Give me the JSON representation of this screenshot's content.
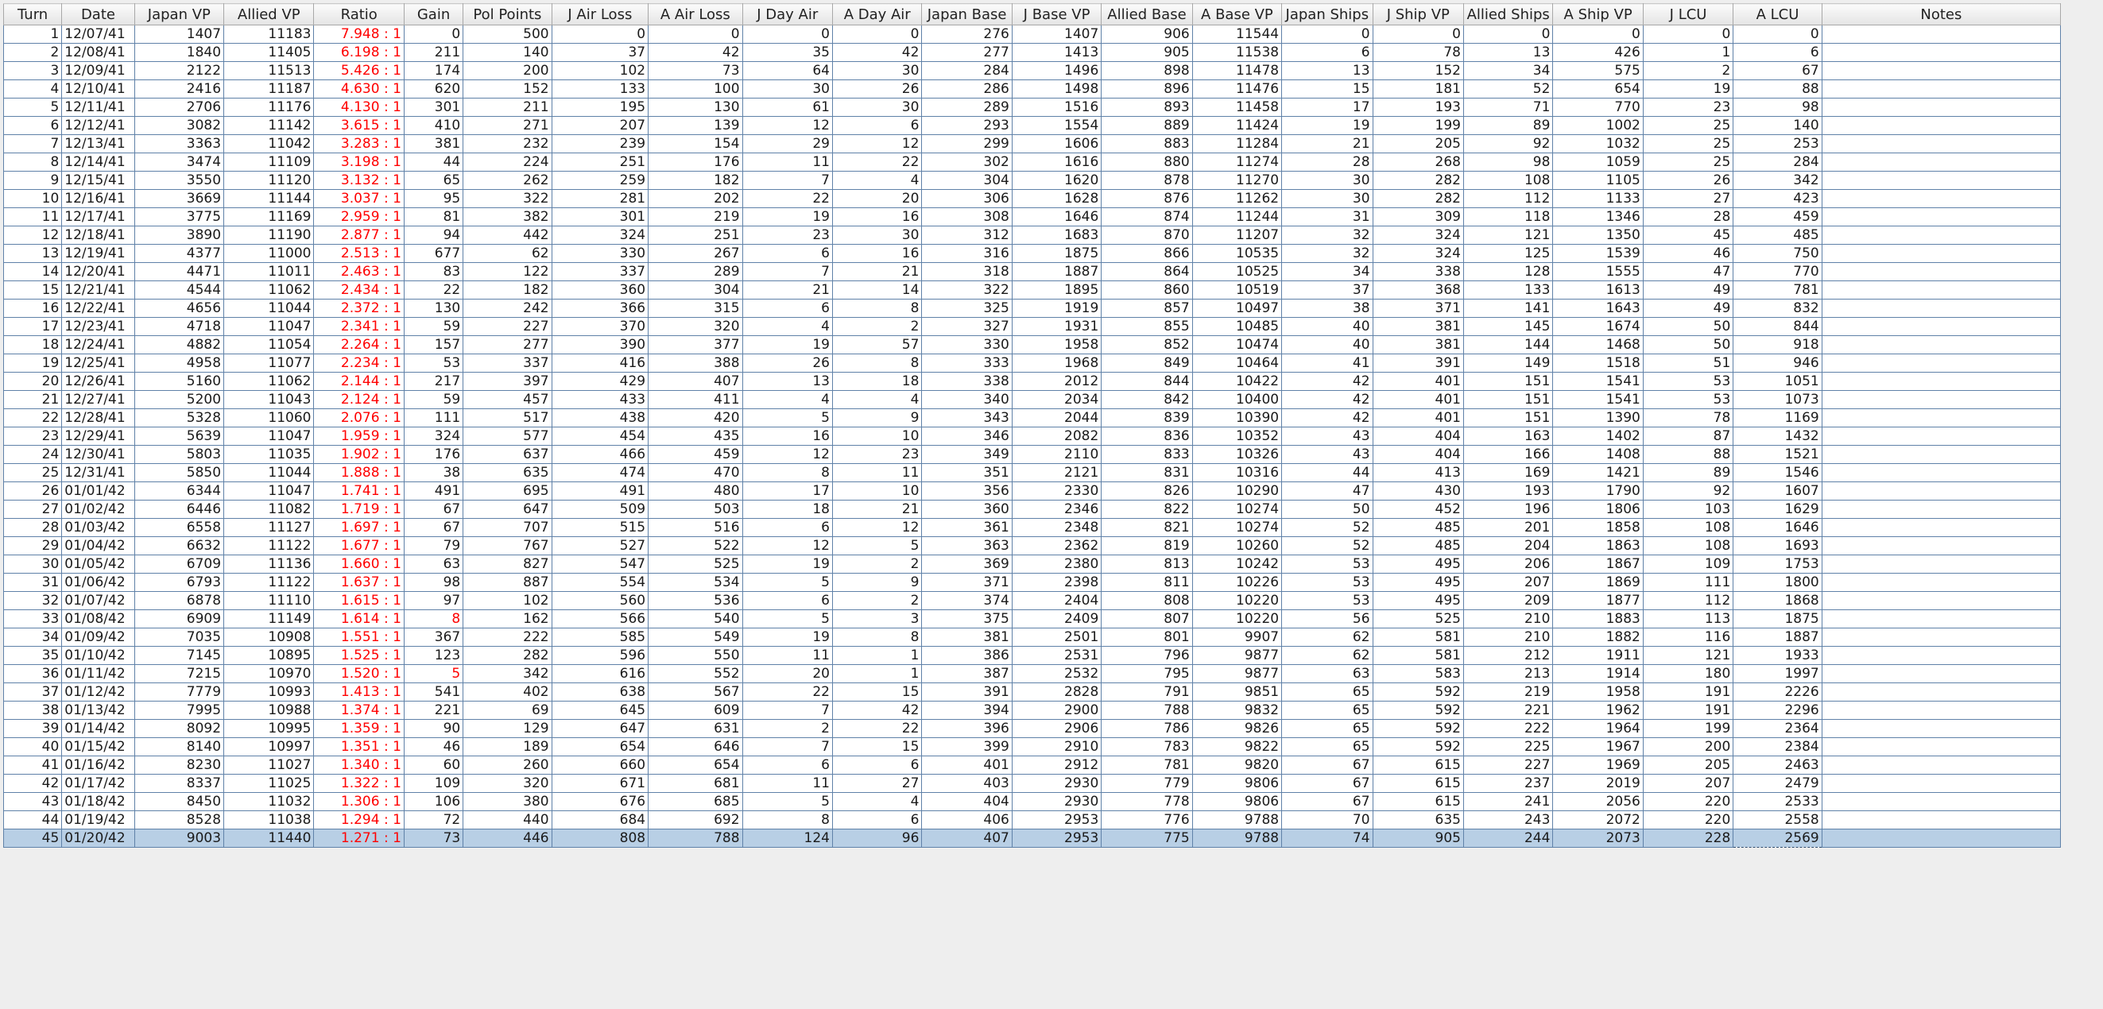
{
  "columns": [
    "Turn",
    "Date",
    "Japan VP",
    "Allied VP",
    "Ratio",
    "Gain",
    "Pol Points",
    "J Air Loss",
    "A Air Loss",
    "J Day Air",
    "A Day Air",
    "Japan Base",
    "J Base VP",
    "Allied Base",
    "A Base VP",
    "Japan Ships",
    "J Ship VP",
    "Allied Ships",
    "A Ship VP",
    "J LCU",
    "A LCU",
    "Notes"
  ],
  "colors": {
    "ratio_text": "#ff0000",
    "selected_row": "#b8cfe5",
    "grid_line": "#5f81a8"
  },
  "selected_turn": "45",
  "rows": [
    [
      "1",
      "12/07/41",
      "1407",
      "11183",
      "7.948 : 1",
      "0",
      "500",
      "0",
      "0",
      "0",
      "0",
      "276",
      "1407",
      "906",
      "11544",
      "0",
      "0",
      "0",
      "0",
      "0",
      "0",
      ""
    ],
    [
      "2",
      "12/08/41",
      "1840",
      "11405",
      "6.198 : 1",
      "211",
      "140",
      "37",
      "42",
      "35",
      "42",
      "277",
      "1413",
      "905",
      "11538",
      "6",
      "78",
      "13",
      "426",
      "1",
      "6",
      ""
    ],
    [
      "3",
      "12/09/41",
      "2122",
      "11513",
      "5.426 : 1",
      "174",
      "200",
      "102",
      "73",
      "64",
      "30",
      "284",
      "1496",
      "898",
      "11478",
      "13",
      "152",
      "34",
      "575",
      "2",
      "67",
      ""
    ],
    [
      "4",
      "12/10/41",
      "2416",
      "11187",
      "4.630 : 1",
      "620",
      "152",
      "133",
      "100",
      "30",
      "26",
      "286",
      "1498",
      "896",
      "11476",
      "15",
      "181",
      "52",
      "654",
      "19",
      "88",
      ""
    ],
    [
      "5",
      "12/11/41",
      "2706",
      "11176",
      "4.130 : 1",
      "301",
      "211",
      "195",
      "130",
      "61",
      "30",
      "289",
      "1516",
      "893",
      "11458",
      "17",
      "193",
      "71",
      "770",
      "23",
      "98",
      ""
    ],
    [
      "6",
      "12/12/41",
      "3082",
      "11142",
      "3.615 : 1",
      "410",
      "271",
      "207",
      "139",
      "12",
      "6",
      "293",
      "1554",
      "889",
      "11424",
      "19",
      "199",
      "89",
      "1002",
      "25",
      "140",
      ""
    ],
    [
      "7",
      "12/13/41",
      "3363",
      "11042",
      "3.283 : 1",
      "381",
      "232",
      "239",
      "154",
      "29",
      "12",
      "299",
      "1606",
      "883",
      "11284",
      "21",
      "205",
      "92",
      "1032",
      "25",
      "253",
      ""
    ],
    [
      "8",
      "12/14/41",
      "3474",
      "11109",
      "3.198 : 1",
      "44",
      "224",
      "251",
      "176",
      "11",
      "22",
      "302",
      "1616",
      "880",
      "11274",
      "28",
      "268",
      "98",
      "1059",
      "25",
      "284",
      ""
    ],
    [
      "9",
      "12/15/41",
      "3550",
      "11120",
      "3.132 : 1",
      "65",
      "262",
      "259",
      "182",
      "7",
      "4",
      "304",
      "1620",
      "878",
      "11270",
      "30",
      "282",
      "108",
      "1105",
      "26",
      "342",
      ""
    ],
    [
      "10",
      "12/16/41",
      "3669",
      "11144",
      "3.037 : 1",
      "95",
      "322",
      "281",
      "202",
      "22",
      "20",
      "306",
      "1628",
      "876",
      "11262",
      "30",
      "282",
      "112",
      "1133",
      "27",
      "423",
      ""
    ],
    [
      "11",
      "12/17/41",
      "3775",
      "11169",
      "2.959 : 1",
      "81",
      "382",
      "301",
      "219",
      "19",
      "16",
      "308",
      "1646",
      "874",
      "11244",
      "31",
      "309",
      "118",
      "1346",
      "28",
      "459",
      ""
    ],
    [
      "12",
      "12/18/41",
      "3890",
      "11190",
      "2.877 : 1",
      "94",
      "442",
      "324",
      "251",
      "23",
      "30",
      "312",
      "1683",
      "870",
      "11207",
      "32",
      "324",
      "121",
      "1350",
      "45",
      "485",
      ""
    ],
    [
      "13",
      "12/19/41",
      "4377",
      "11000",
      "2.513 : 1",
      "677",
      "62",
      "330",
      "267",
      "6",
      "16",
      "316",
      "1875",
      "866",
      "10535",
      "32",
      "324",
      "125",
      "1539",
      "46",
      "750",
      ""
    ],
    [
      "14",
      "12/20/41",
      "4471",
      "11011",
      "2.463 : 1",
      "83",
      "122",
      "337",
      "289",
      "7",
      "21",
      "318",
      "1887",
      "864",
      "10525",
      "34",
      "338",
      "128",
      "1555",
      "47",
      "770",
      ""
    ],
    [
      "15",
      "12/21/41",
      "4544",
      "11062",
      "2.434 : 1",
      "22",
      "182",
      "360",
      "304",
      "21",
      "14",
      "322",
      "1895",
      "860",
      "10519",
      "37",
      "368",
      "133",
      "1613",
      "49",
      "781",
      ""
    ],
    [
      "16",
      "12/22/41",
      "4656",
      "11044",
      "2.372 : 1",
      "130",
      "242",
      "366",
      "315",
      "6",
      "8",
      "325",
      "1919",
      "857",
      "10497",
      "38",
      "371",
      "141",
      "1643",
      "49",
      "832",
      ""
    ],
    [
      "17",
      "12/23/41",
      "4718",
      "11047",
      "2.341 : 1",
      "59",
      "227",
      "370",
      "320",
      "4",
      "2",
      "327",
      "1931",
      "855",
      "10485",
      "40",
      "381",
      "145",
      "1674",
      "50",
      "844",
      ""
    ],
    [
      "18",
      "12/24/41",
      "4882",
      "11054",
      "2.264 : 1",
      "157",
      "277",
      "390",
      "377",
      "19",
      "57",
      "330",
      "1958",
      "852",
      "10474",
      "40",
      "381",
      "144",
      "1468",
      "50",
      "918",
      ""
    ],
    [
      "19",
      "12/25/41",
      "4958",
      "11077",
      "2.234 : 1",
      "53",
      "337",
      "416",
      "388",
      "26",
      "8",
      "333",
      "1968",
      "849",
      "10464",
      "41",
      "391",
      "149",
      "1518",
      "51",
      "946",
      ""
    ],
    [
      "20",
      "12/26/41",
      "5160",
      "11062",
      "2.144 : 1",
      "217",
      "397",
      "429",
      "407",
      "13",
      "18",
      "338",
      "2012",
      "844",
      "10422",
      "42",
      "401",
      "151",
      "1541",
      "53",
      "1051",
      ""
    ],
    [
      "21",
      "12/27/41",
      "5200",
      "11043",
      "2.124 : 1",
      "59",
      "457",
      "433",
      "411",
      "4",
      "4",
      "340",
      "2034",
      "842",
      "10400",
      "42",
      "401",
      "151",
      "1541",
      "53",
      "1073",
      ""
    ],
    [
      "22",
      "12/28/41",
      "5328",
      "11060",
      "2.076 : 1",
      "111",
      "517",
      "438",
      "420",
      "5",
      "9",
      "343",
      "2044",
      "839",
      "10390",
      "42",
      "401",
      "151",
      "1390",
      "78",
      "1169",
      ""
    ],
    [
      "23",
      "12/29/41",
      "5639",
      "11047",
      "1.959 : 1",
      "324",
      "577",
      "454",
      "435",
      "16",
      "10",
      "346",
      "2082",
      "836",
      "10352",
      "43",
      "404",
      "163",
      "1402",
      "87",
      "1432",
      ""
    ],
    [
      "24",
      "12/30/41",
      "5803",
      "11035",
      "1.902 : 1",
      "176",
      "637",
      "466",
      "459",
      "12",
      "23",
      "349",
      "2110",
      "833",
      "10326",
      "43",
      "404",
      "166",
      "1408",
      "88",
      "1521",
      ""
    ],
    [
      "25",
      "12/31/41",
      "5850",
      "11044",
      "1.888 : 1",
      "38",
      "635",
      "474",
      "470",
      "8",
      "11",
      "351",
      "2121",
      "831",
      "10316",
      "44",
      "413",
      "169",
      "1421",
      "89",
      "1546",
      ""
    ],
    [
      "26",
      "01/01/42",
      "6344",
      "11047",
      "1.741 : 1",
      "491",
      "695",
      "491",
      "480",
      "17",
      "10",
      "356",
      "2330",
      "826",
      "10290",
      "47",
      "430",
      "193",
      "1790",
      "92",
      "1607",
      ""
    ],
    [
      "27",
      "01/02/42",
      "6446",
      "11082",
      "1.719 : 1",
      "67",
      "647",
      "509",
      "503",
      "18",
      "21",
      "360",
      "2346",
      "822",
      "10274",
      "50",
      "452",
      "196",
      "1806",
      "103",
      "1629",
      ""
    ],
    [
      "28",
      "01/03/42",
      "6558",
      "11127",
      "1.697 : 1",
      "67",
      "707",
      "515",
      "516",
      "6",
      "12",
      "361",
      "2348",
      "821",
      "10274",
      "52",
      "485",
      "201",
      "1858",
      "108",
      "1646",
      ""
    ],
    [
      "29",
      "01/04/42",
      "6632",
      "11122",
      "1.677 : 1",
      "79",
      "767",
      "527",
      "522",
      "12",
      "5",
      "363",
      "2362",
      "819",
      "10260",
      "52",
      "485",
      "204",
      "1863",
      "108",
      "1693",
      ""
    ],
    [
      "30",
      "01/05/42",
      "6709",
      "11136",
      "1.660 : 1",
      "63",
      "827",
      "547",
      "525",
      "19",
      "2",
      "369",
      "2380",
      "813",
      "10242",
      "53",
      "495",
      "206",
      "1867",
      "109",
      "1753",
      ""
    ],
    [
      "31",
      "01/06/42",
      "6793",
      "11122",
      "1.637 : 1",
      "98",
      "887",
      "554",
      "534",
      "5",
      "9",
      "371",
      "2398",
      "811",
      "10226",
      "53",
      "495",
      "207",
      "1869",
      "111",
      "1800",
      ""
    ],
    [
      "32",
      "01/07/42",
      "6878",
      "11110",
      "1.615 : 1",
      "97",
      "102",
      "560",
      "536",
      "6",
      "2",
      "374",
      "2404",
      "808",
      "10220",
      "53",
      "495",
      "209",
      "1877",
      "112",
      "1868",
      ""
    ],
    [
      "33",
      "01/08/42",
      "6909",
      "11149",
      "1.614 : 1",
      "8",
      "162",
      "566",
      "540",
      "5",
      "3",
      "375",
      "2409",
      "807",
      "10220",
      "56",
      "525",
      "210",
      "1883",
      "113",
      "1875",
      ""
    ],
    [
      "34",
      "01/09/42",
      "7035",
      "10908",
      "1.551 : 1",
      "367",
      "222",
      "585",
      "549",
      "19",
      "8",
      "381",
      "2501",
      "801",
      "9907",
      "62",
      "581",
      "210",
      "1882",
      "116",
      "1887",
      ""
    ],
    [
      "35",
      "01/10/42",
      "7145",
      "10895",
      "1.525 : 1",
      "123",
      "282",
      "596",
      "550",
      "11",
      "1",
      "386",
      "2531",
      "796",
      "9877",
      "62",
      "581",
      "212",
      "1911",
      "121",
      "1933",
      ""
    ],
    [
      "36",
      "01/11/42",
      "7215",
      "10970",
      "1.520 : 1",
      "5",
      "342",
      "616",
      "552",
      "20",
      "1",
      "387",
      "2532",
      "795",
      "9877",
      "63",
      "583",
      "213",
      "1914",
      "180",
      "1997",
      ""
    ],
    [
      "37",
      "01/12/42",
      "7779",
      "10993",
      "1.413 : 1",
      "541",
      "402",
      "638",
      "567",
      "22",
      "15",
      "391",
      "2828",
      "791",
      "9851",
      "65",
      "592",
      "219",
      "1958",
      "191",
      "2226",
      ""
    ],
    [
      "38",
      "01/13/42",
      "7995",
      "10988",
      "1.374 : 1",
      "221",
      "69",
      "645",
      "609",
      "7",
      "42",
      "394",
      "2900",
      "788",
      "9832",
      "65",
      "592",
      "221",
      "1962",
      "191",
      "2296",
      ""
    ],
    [
      "39",
      "01/14/42",
      "8092",
      "10995",
      "1.359 : 1",
      "90",
      "129",
      "647",
      "631",
      "2",
      "22",
      "396",
      "2906",
      "786",
      "9826",
      "65",
      "592",
      "222",
      "1964",
      "199",
      "2364",
      ""
    ],
    [
      "40",
      "01/15/42",
      "8140",
      "10997",
      "1.351 : 1",
      "46",
      "189",
      "654",
      "646",
      "7",
      "15",
      "399",
      "2910",
      "783",
      "9822",
      "65",
      "592",
      "225",
      "1967",
      "200",
      "2384",
      ""
    ],
    [
      "41",
      "01/16/42",
      "8230",
      "11027",
      "1.340 : 1",
      "60",
      "260",
      "660",
      "654",
      "6",
      "6",
      "401",
      "2912",
      "781",
      "9820",
      "67",
      "615",
      "227",
      "1969",
      "205",
      "2463",
      ""
    ],
    [
      "42",
      "01/17/42",
      "8337",
      "11025",
      "1.322 : 1",
      "109",
      "320",
      "671",
      "681",
      "11",
      "27",
      "403",
      "2930",
      "779",
      "9806",
      "67",
      "615",
      "237",
      "2019",
      "207",
      "2479",
      ""
    ],
    [
      "43",
      "01/18/42",
      "8450",
      "11032",
      "1.306 : 1",
      "106",
      "380",
      "676",
      "685",
      "5",
      "4",
      "404",
      "2930",
      "778",
      "9806",
      "67",
      "615",
      "241",
      "2056",
      "220",
      "2533",
      ""
    ],
    [
      "44",
      "01/19/42",
      "8528",
      "11038",
      "1.294 : 1",
      "72",
      "440",
      "684",
      "692",
      "8",
      "6",
      "406",
      "2953",
      "776",
      "9788",
      "70",
      "635",
      "243",
      "2072",
      "220",
      "2558",
      ""
    ],
    [
      "45",
      "01/20/42",
      "9003",
      "11440",
      "1.271 : 1",
      "73",
      "446",
      "808",
      "788",
      "124",
      "96",
      "407",
      "2953",
      "775",
      "9788",
      "74",
      "905",
      "244",
      "2073",
      "228",
      "2569",
      ""
    ]
  ],
  "red_gain_turns": [
    "33",
    "36"
  ]
}
